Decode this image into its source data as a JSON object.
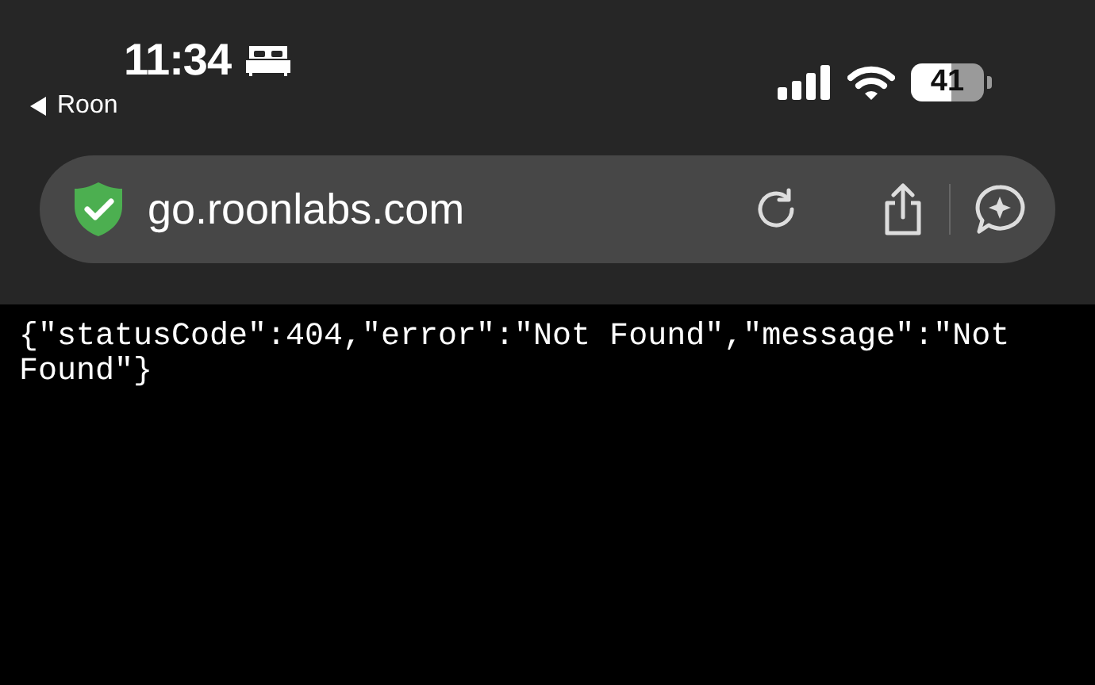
{
  "status_bar": {
    "time": "11:34",
    "back_app": "Roon",
    "battery": "41"
  },
  "address_bar": {
    "url": "go.roonlabs.com"
  },
  "page": {
    "body": "{\"statusCode\":404,\"error\":\"Not Found\",\"message\":\"Not Found\"}"
  }
}
